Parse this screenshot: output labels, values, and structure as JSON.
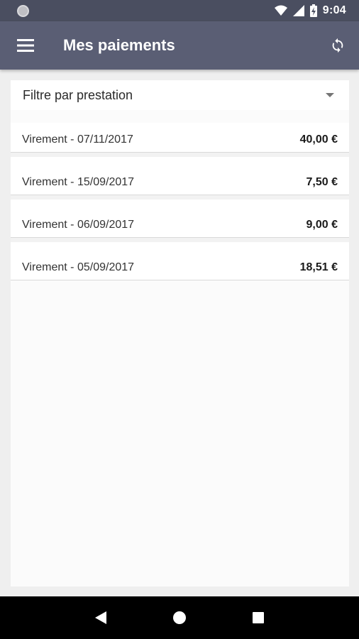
{
  "status_bar": {
    "time": "9:04"
  },
  "app_bar": {
    "title": "Mes paiements"
  },
  "filter": {
    "label": "Filtre par prestation"
  },
  "payments": [
    {
      "description": "Virement - 07/11/2017",
      "amount": "40,00 €"
    },
    {
      "description": "Virement - 15/09/2017",
      "amount": "7,50 €"
    },
    {
      "description": "Virement - 06/09/2017",
      "amount": "9,00 €"
    },
    {
      "description": "Virement - 05/09/2017",
      "amount": "18,51 €"
    }
  ],
  "icons": {
    "menu": "hamburger-menu-icon",
    "refresh": "refresh-icon",
    "dropdown": "dropdown-arrow-icon",
    "nav_back": "back-triangle-icon",
    "nav_home": "home-circle-icon",
    "nav_recents": "recents-square-icon"
  },
  "colors": {
    "status_bar": "#4a4e60",
    "app_bar": "#5a5e74",
    "background": "#efefef"
  }
}
